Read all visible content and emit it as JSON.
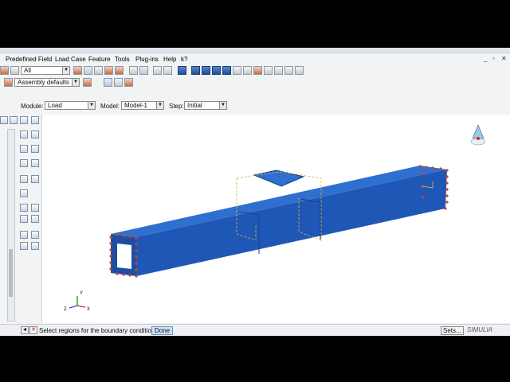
{
  "menu": {
    "items": [
      {
        "label": "Predefined Field",
        "u": "F"
      },
      {
        "label": "Load Case",
        "u": "L"
      },
      {
        "label": "Feature",
        "u": "F"
      },
      {
        "label": "Tools",
        "u": "T"
      },
      {
        "label": "Plug-ins",
        "u": "P"
      },
      {
        "label": "Help",
        "u": "H"
      },
      {
        "label": "k?"
      }
    ],
    "window_controls": [
      "_",
      "▫",
      "✕"
    ]
  },
  "toolbar": {
    "selection_filter": "All",
    "render_style": "Assembly defaults"
  },
  "context": {
    "module_label": "Module:",
    "module_value": "Load",
    "model_label": "Model:",
    "model_value": "Model-1",
    "step_label": "Step:",
    "step_value": "Initial"
  },
  "prompt": {
    "message": "Select regions for the boundary condition",
    "done_label": "Done",
    "sets_label": "Sets..."
  },
  "branding": {
    "logo_text": "SIMULIA"
  },
  "triad": {
    "x_label": "X",
    "y_label": "Y",
    "z_label": "Z"
  },
  "colors": {
    "beam_top": "#2f6fd0",
    "beam_front": "#1f57b6",
    "beam_end": "#1d4ea3",
    "constraint_marker": "#d0402a",
    "selection_dash": "#e0c040",
    "app_bg": "#f2f3f5"
  }
}
